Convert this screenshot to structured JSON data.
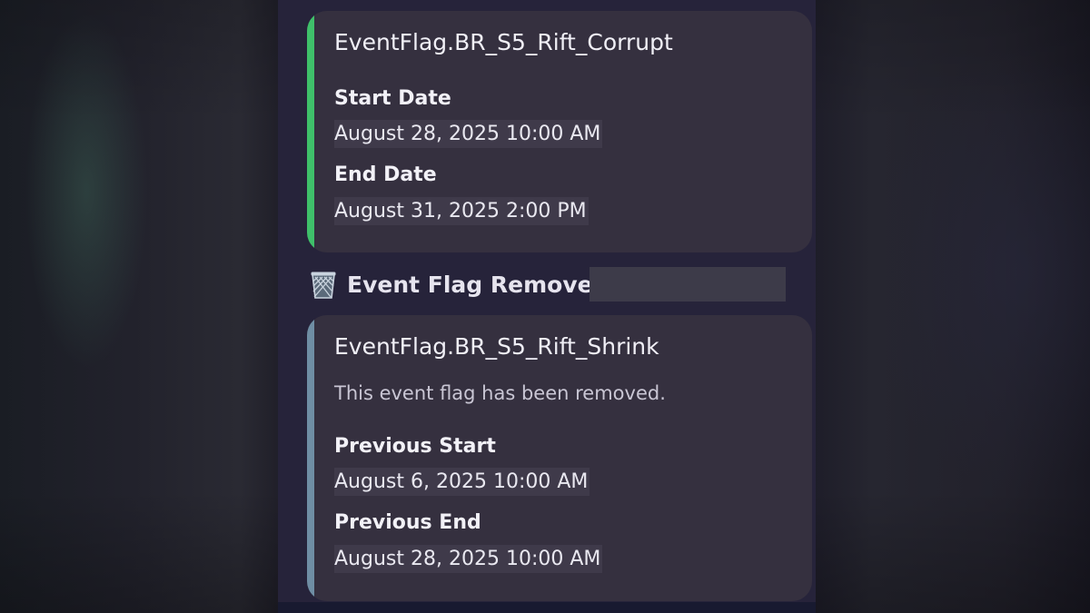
{
  "cards": [
    {
      "title": "EventFlag.BR_S5_Rift_Corrupt",
      "accent": "#3fc06a",
      "fields": [
        {
          "label": "Start Date",
          "value": "August 28, 2025 10:00 AM"
        },
        {
          "label": "End Date",
          "value": "August 31, 2025 2:00 PM"
        }
      ]
    },
    {
      "title": "EventFlag.BR_S5_Rift_Shrink",
      "accent": "#6f8ea4",
      "description": "This event flag has been removed.",
      "fields": [
        {
          "label": "Previous Start",
          "value": "August 6, 2025 10:00 AM"
        },
        {
          "label": "Previous End",
          "value": "August 28, 2025 10:00 AM"
        }
      ]
    }
  ],
  "removed_header": {
    "icon": "wastebasket-icon",
    "label": "Event Flag Removed"
  },
  "colors": {
    "card_bg": "#35303f",
    "chat_bg": "#26233a",
    "redaction": "#3d3b49"
  }
}
